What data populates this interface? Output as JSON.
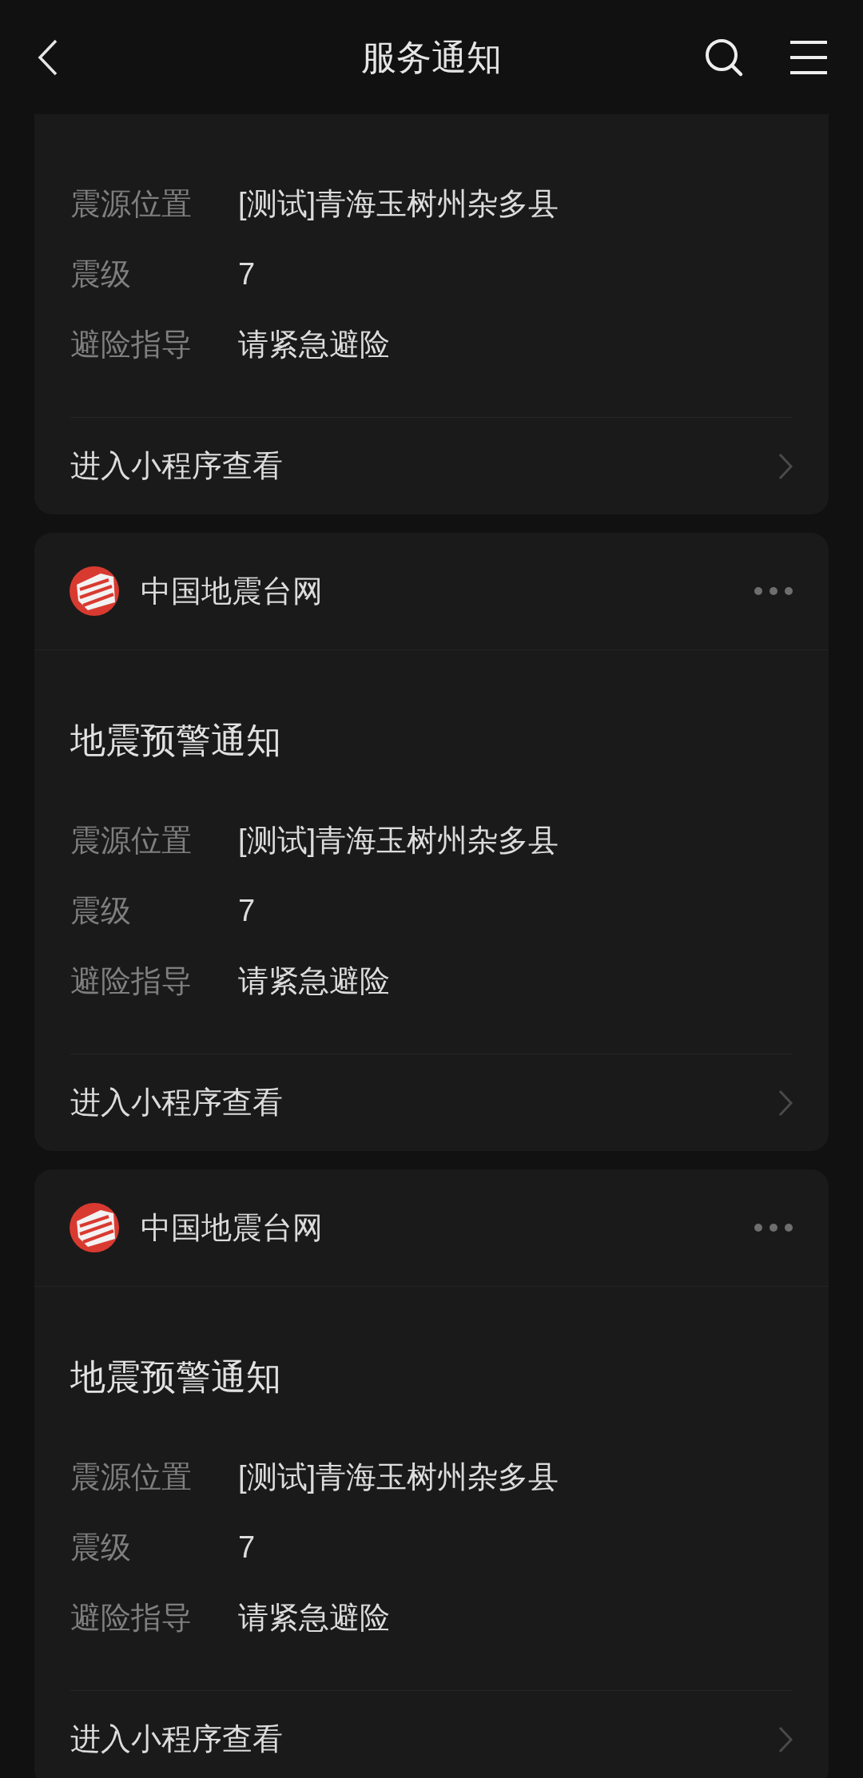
{
  "header": {
    "title": "服务通知"
  },
  "cards": [
    {
      "fields": [
        {
          "label": "震源位置",
          "value": "[测试]青海玉树州杂多县"
        },
        {
          "label": "震级",
          "value": "7"
        },
        {
          "label": "避险指导",
          "value": "请紧急避险"
        }
      ],
      "link": "进入小程序查看"
    },
    {
      "source": "中国地震台网",
      "title": "地震预警通知",
      "fields": [
        {
          "label": "震源位置",
          "value": "[测试]青海玉树州杂多县"
        },
        {
          "label": "震级",
          "value": "7"
        },
        {
          "label": "避险指导",
          "value": "请紧急避险"
        }
      ],
      "link": "进入小程序查看"
    },
    {
      "source": "中国地震台网",
      "title": "地震预警通知",
      "fields": [
        {
          "label": "震源位置",
          "value": "[测试]青海玉树州杂多县"
        },
        {
          "label": "震级",
          "value": "7"
        },
        {
          "label": "避险指导",
          "value": "请紧急避险"
        }
      ],
      "link": "进入小程序查看"
    }
  ]
}
